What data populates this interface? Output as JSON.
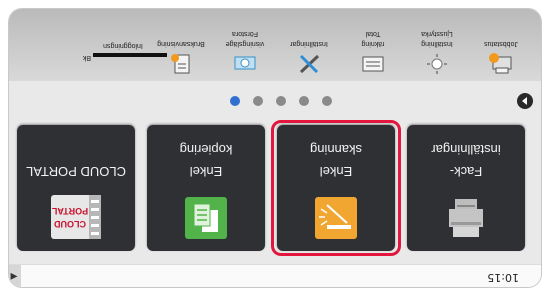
{
  "status": {
    "time": "10:15",
    "side_arrow": "◀"
  },
  "tiles": [
    {
      "line1": "Fack-",
      "line2": "inställningar"
    },
    {
      "line1": "Enkel",
      "line2": "skanning"
    },
    {
      "line1": "Enkel",
      "line2": "kopiering"
    },
    {
      "line1": "CLOUD PORTAL",
      "line2": ""
    }
  ],
  "cloud_logo": {
    "top": "CLOUD",
    "bottom": "PORTAL"
  },
  "pager": {
    "page_count": 5,
    "active_index": 0
  },
  "shortcuts": [
    {
      "line1": "Jobbstatus",
      "line2": "",
      "line3": "",
      "icon": "job-status-icon"
    },
    {
      "line1": "Inställning",
      "line2": "Ljusstyrka",
      "line3": "",
      "icon": "brightness-icon"
    },
    {
      "line1": "räkning",
      "line2": "Total",
      "line3": "",
      "icon": "total-count-icon"
    },
    {
      "line1": "Inställningar",
      "line2": "",
      "line3": "",
      "icon": "settings-icon"
    },
    {
      "line1": "visningsläge",
      "line2": "Förstora",
      "line3": "",
      "icon": "magnify-icon"
    },
    {
      "line1": "Bruksanvisning",
      "line2": "",
      "line3": "",
      "icon": "manual-icon"
    }
  ],
  "login": {
    "label": "Inloggningsn",
    "prefix": "Bk"
  },
  "colors": {
    "highlight": "#e3173e",
    "tile_bg": "#2f3034",
    "scan_icon": "#f2a632",
    "copy_icon": "#52b34a",
    "active_dot": "#2f6fd0"
  }
}
